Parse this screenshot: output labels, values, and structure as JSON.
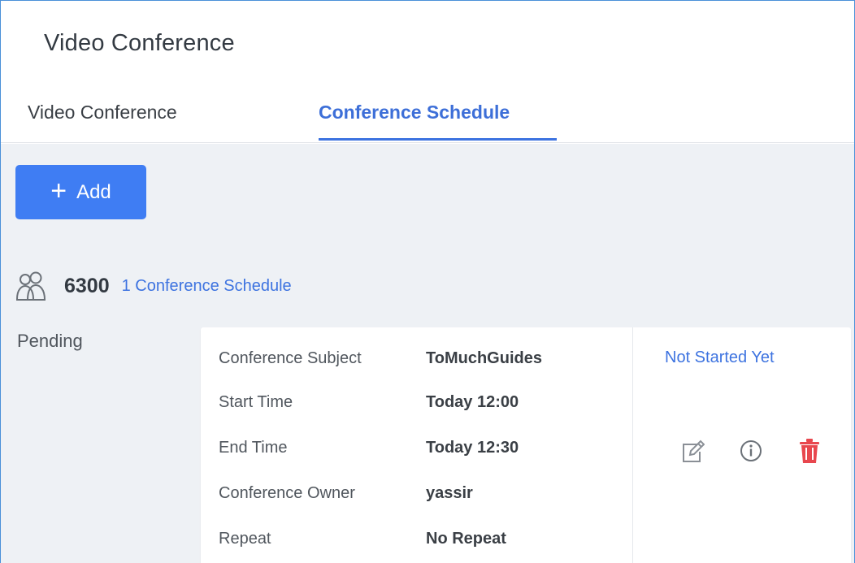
{
  "header": {
    "title": "Video Conference",
    "tabs": [
      {
        "label": "Video Conference",
        "active": false
      },
      {
        "label": "Conference Schedule",
        "active": true
      }
    ]
  },
  "toolbar": {
    "add_label": "Add",
    "add_icon": "plus-icon"
  },
  "conference": {
    "icon": "people-icon",
    "number": "6300",
    "schedule_link": "1 Conference Schedule"
  },
  "pending": {
    "label": "Pending",
    "schedule": {
      "fields": [
        {
          "label": "Conference Subject",
          "value": "ToMuchGuides"
        },
        {
          "label": "Start Time",
          "value": "Today 12:00"
        },
        {
          "label": "End Time",
          "value": "Today 12:30"
        },
        {
          "label": "Conference Owner",
          "value": "yassir"
        },
        {
          "label": "Repeat",
          "value": "No Repeat"
        }
      ],
      "status": "Not Started Yet",
      "actions": [
        "edit-icon",
        "info-icon",
        "delete-icon"
      ]
    }
  },
  "colors": {
    "accent": "#3f7df3",
    "link": "#3d73e0",
    "delete": "#e8474e",
    "icon_gray": "#8a8f96",
    "content_bg": "#eef1f5"
  }
}
